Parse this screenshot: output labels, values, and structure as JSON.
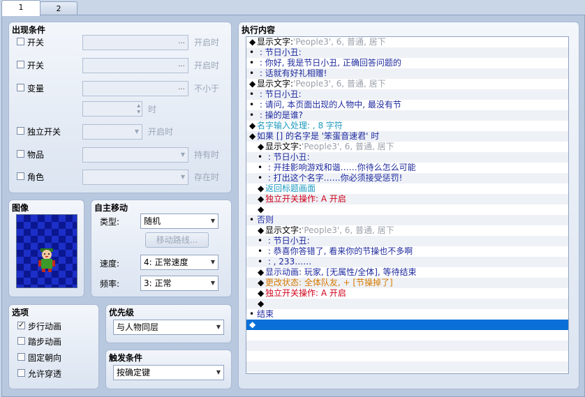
{
  "tabs": [
    "1",
    "2"
  ],
  "conditions": {
    "title": "出现条件",
    "rows": [
      {
        "label": "开关",
        "hint": "开启时"
      },
      {
        "label": "开关",
        "hint": "开启时"
      },
      {
        "label": "变量",
        "hint": "不小于"
      },
      {
        "label": "",
        "hint": "时"
      },
      {
        "label": "独立开关",
        "hint": "开启时"
      },
      {
        "label": "物品",
        "hint": "持有时"
      },
      {
        "label": "角色",
        "hint": "存在时"
      }
    ],
    "dots": "..."
  },
  "image": {
    "title": "图像"
  },
  "autonomous": {
    "title": "自主移动",
    "type_label": "类型:",
    "type_value": "随机",
    "route_button": "移动路线...",
    "speed_label": "速度:",
    "speed_value": "4: 正常速度",
    "freq_label": "频率:",
    "freq_value": "3: 正常"
  },
  "options": {
    "title": "选项",
    "items": [
      {
        "label": "步行动画",
        "checked": true
      },
      {
        "label": "踏步动画",
        "checked": false
      },
      {
        "label": "固定朝向",
        "checked": false
      },
      {
        "label": "允许穿透",
        "checked": false
      }
    ]
  },
  "priority": {
    "title": "优先级",
    "value": "与人物同层"
  },
  "trigger": {
    "title": "触发条件",
    "value": "按确定键"
  },
  "commands": {
    "title": "执行内容",
    "lines": [
      {
        "indent": 0,
        "mark": "◆",
        "segs": [
          {
            "t": "显示文字:",
            "c": "black"
          },
          {
            "t": "'People3', 6, 普通, 居下",
            "c": "gray"
          }
        ]
      },
      {
        "indent": 0,
        "mark": "•",
        "segs": [
          {
            "t": "          : 节日小丑:",
            "c": "blue"
          }
        ]
      },
      {
        "indent": 0,
        "mark": "•",
        "segs": [
          {
            "t": "          : 你好, 我是节日小丑, 正确回答问题的",
            "c": "blue"
          }
        ]
      },
      {
        "indent": 0,
        "mark": "•",
        "segs": [
          {
            "t": "          : 话就有好礼相赠!",
            "c": "blue"
          }
        ]
      },
      {
        "indent": 0,
        "mark": "◆",
        "segs": [
          {
            "t": "显示文字:",
            "c": "black"
          },
          {
            "t": "'People3', 6, 普通, 居下",
            "c": "gray"
          }
        ]
      },
      {
        "indent": 0,
        "mark": "•",
        "segs": [
          {
            "t": "          : 节日小丑:",
            "c": "blue"
          }
        ]
      },
      {
        "indent": 0,
        "mark": "•",
        "segs": [
          {
            "t": "          : 请问, 本页面出现的人物中, 最没有节",
            "c": "blue"
          }
        ]
      },
      {
        "indent": 0,
        "mark": "•",
        "segs": [
          {
            "t": "          : 操的是谁?",
            "c": "blue"
          }
        ]
      },
      {
        "indent": 0,
        "mark": "◆",
        "segs": [
          {
            "t": "名字输入处理: , 8 字符",
            "c": "cyan"
          }
        ]
      },
      {
        "indent": 0,
        "mark": "◆",
        "segs": [
          {
            "t": "如果 [] 的名字是 '笨蛋音速君' 时",
            "c": "blue"
          }
        ]
      },
      {
        "indent": 1,
        "mark": "◆",
        "segs": [
          {
            "t": "显示文字:",
            "c": "black"
          },
          {
            "t": "'People3', 6, 普通, 居下",
            "c": "gray"
          }
        ]
      },
      {
        "indent": 1,
        "mark": "•",
        "segs": [
          {
            "t": "          : 节日小丑:",
            "c": "blue"
          }
        ]
      },
      {
        "indent": 1,
        "mark": "•",
        "segs": [
          {
            "t": "          : 开挂影响游戏和谐……你待么怎么可能",
            "c": "blue"
          }
        ]
      },
      {
        "indent": 1,
        "mark": "•",
        "segs": [
          {
            "t": "          : 打出这个名字……你必须接受惩罚!",
            "c": "blue"
          }
        ]
      },
      {
        "indent": 1,
        "mark": "◆",
        "segs": [
          {
            "t": "返回标题画面",
            "c": "cyan"
          }
        ]
      },
      {
        "indent": 1,
        "mark": "◆",
        "segs": [
          {
            "t": "独立开关操作: A 开启",
            "c": "red"
          }
        ]
      },
      {
        "indent": 1,
        "mark": "◆",
        "segs": []
      },
      {
        "indent": 0,
        "mark": "•",
        "segs": [
          {
            "t": "否则",
            "c": "blue"
          }
        ]
      },
      {
        "indent": 1,
        "mark": "◆",
        "segs": [
          {
            "t": "显示文字:",
            "c": "black"
          },
          {
            "t": "'People3', 6, 普通, 居下",
            "c": "gray"
          }
        ]
      },
      {
        "indent": 1,
        "mark": "•",
        "segs": [
          {
            "t": "          : 节日小丑:",
            "c": "blue"
          }
        ]
      },
      {
        "indent": 1,
        "mark": "•",
        "segs": [
          {
            "t": "          : 恭喜你答错了, 看来你的节操也不多啊",
            "c": "blue"
          }
        ]
      },
      {
        "indent": 1,
        "mark": "•",
        "segs": [
          {
            "t": "          : , 233……",
            "c": "blue"
          }
        ]
      },
      {
        "indent": 1,
        "mark": "◆",
        "segs": [
          {
            "t": "显示动画: 玩家, [无属性/全体], 等待结束",
            "c": "blue"
          }
        ]
      },
      {
        "indent": 1,
        "mark": "◆",
        "segs": [
          {
            "t": "更改状态: 全体队友, + [节操掉了]",
            "c": "orange"
          }
        ]
      },
      {
        "indent": 1,
        "mark": "◆",
        "segs": [
          {
            "t": "独立开关操作: A 开启",
            "c": "red"
          }
        ]
      },
      {
        "indent": 1,
        "mark": "◆",
        "segs": []
      },
      {
        "indent": 0,
        "mark": "•",
        "segs": [
          {
            "t": "结束",
            "c": "blue"
          }
        ]
      },
      {
        "indent": 0,
        "mark": "◆",
        "segs": [],
        "selected": true
      },
      {
        "indent": 0,
        "mark": "",
        "segs": []
      },
      {
        "indent": 0,
        "mark": "",
        "segs": []
      },
      {
        "indent": 0,
        "mark": "",
        "segs": []
      },
      {
        "indent": 0,
        "mark": "",
        "segs": []
      }
    ]
  },
  "colors": {
    "selection": "#0a6fd6",
    "text_blue": "#1e2a9e",
    "text_cyan": "#1e9abf",
    "text_red": "#d0021b",
    "text_orange": "#d77a00"
  }
}
